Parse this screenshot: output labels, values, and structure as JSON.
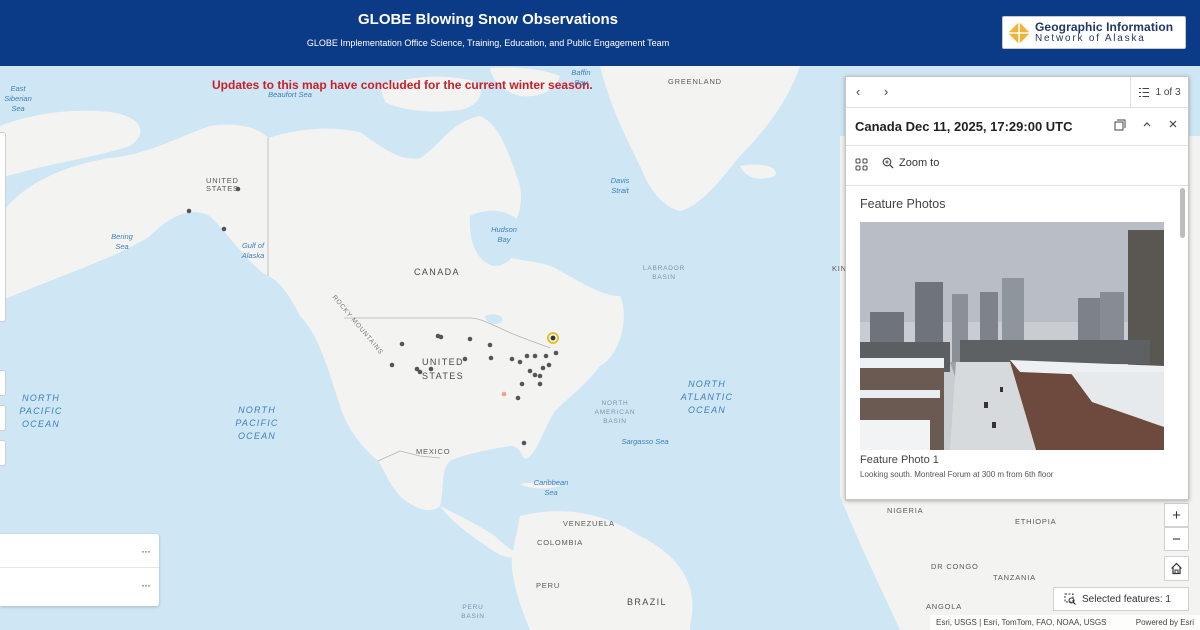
{
  "header": {
    "title": "GLOBE Blowing Snow Observations",
    "subtitle": "GLOBE Implementation Office Science, Training, Education, and Public Engagement Team",
    "logo_line1": "Geographic Information",
    "logo_line2": "Network of Alaska",
    "background": "#0b3b86"
  },
  "map": {
    "notice": "Updates to this map have concluded for the current winter season.",
    "notice_color": "#c8202a",
    "country_labels": [
      "UNITED STATES",
      "UNITED",
      "STATES",
      "CANADA",
      "GREENLAND",
      "MEXICO",
      "VENEZUELA",
      "COLOMBIA",
      "PERU",
      "BRAZIL",
      "NIGERIA",
      "DR CONGO",
      "ETHIOPIA",
      "TANZANIA",
      "ANGOLA",
      "KING"
    ],
    "water_labels": [
      "East Siberian Sea",
      "Beaufort Sea",
      "Baffin Bay",
      "Davis Strait",
      "Bering Sea",
      "Gulf of Alaska",
      "Hudson Bay",
      "LABRADOR BASIN",
      "NORTH AMERICAN BASIN",
      "Sargasso Sea",
      "Caribbean Sea",
      "PERU BASIN",
      "ROCKY MOUNTAINS"
    ],
    "ocean_labels": [
      "NORTH PACIFIC OCEAN",
      "NORTH PACIFIC OCEAN",
      "NORTH ATLANTIC OCEAN"
    ],
    "dot_color": "#555555",
    "selected_color": "#e6c229"
  },
  "layers": {
    "row1_menu": "···",
    "row2_menu": "···"
  },
  "popup": {
    "prev": "‹",
    "next": "›",
    "count": "1 of 3",
    "title": "Canada Dec 11, 2025, 17:29:00 UTC",
    "zoom_to": "Zoom to",
    "section": "Feature Photos",
    "photo_name": "Feature Photo 1",
    "photo_desc": "Looking south. Montreal Forum at 300 m from 6th floor"
  },
  "controls": {
    "zoom_in": "+",
    "zoom_out": "−",
    "selected_features": "Selected features: 1",
    "attribution": "Esri, USGS | Esri, TomTom, FAO, NOAA, USGS",
    "powered_by": "Powered by Esri"
  }
}
